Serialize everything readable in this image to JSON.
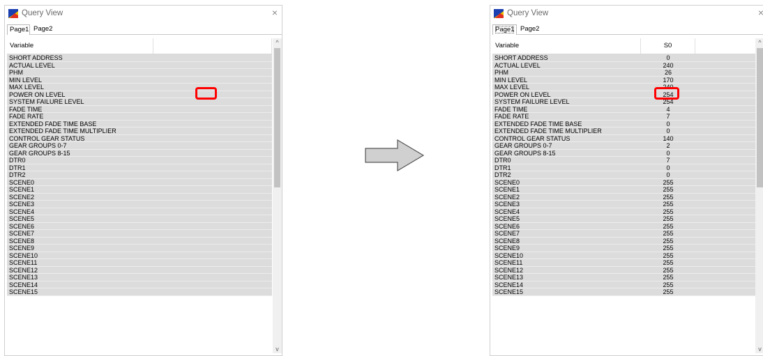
{
  "left_window": {
    "title": "Query View",
    "close_glyph": "×",
    "tabs": [
      "Page1",
      "Page2"
    ],
    "header": {
      "variable": "Variable",
      "value": ""
    },
    "rows": [
      {
        "name": "SHORT ADDRESS"
      },
      {
        "name": "ACTUAL LEVEL"
      },
      {
        "name": "PHM"
      },
      {
        "name": "MIN LEVEL"
      },
      {
        "name": "MAX LEVEL"
      },
      {
        "name": "POWER ON LEVEL"
      },
      {
        "name": "SYSTEM FAILURE LEVEL"
      },
      {
        "name": "FADE TIME"
      },
      {
        "name": "FADE RATE"
      },
      {
        "name": "EXTENDED FADE TIME BASE"
      },
      {
        "name": "EXTENDED FADE TIME MULTIPLIER"
      },
      {
        "name": "CONTROL GEAR STATUS"
      },
      {
        "name": "GEAR GROUPS 0-7"
      },
      {
        "name": "GEAR GROUPS 8-15"
      },
      {
        "name": "DTR0"
      },
      {
        "name": "DTR1"
      },
      {
        "name": "DTR2"
      },
      {
        "name": "SCENE0"
      },
      {
        "name": "SCENE1"
      },
      {
        "name": "SCENE2"
      },
      {
        "name": "SCENE3"
      },
      {
        "name": "SCENE4"
      },
      {
        "name": "SCENE5"
      },
      {
        "name": "SCENE6"
      },
      {
        "name": "SCENE7"
      },
      {
        "name": "SCENE8"
      },
      {
        "name": "SCENE9"
      },
      {
        "name": "SCENE10"
      },
      {
        "name": "SCENE11"
      },
      {
        "name": "SCENE12"
      },
      {
        "name": "SCENE13"
      },
      {
        "name": "SCENE14"
      },
      {
        "name": "SCENE15"
      }
    ],
    "scroll_up": "^",
    "scroll_down": "v"
  },
  "right_window": {
    "title": "Query View",
    "close_glyph": "×",
    "tabs": [
      "Page1",
      "Page2"
    ],
    "header": {
      "variable": "Variable",
      "value": "S0"
    },
    "rows": [
      {
        "name": "SHORT ADDRESS",
        "value": "0"
      },
      {
        "name": "ACTUAL LEVEL",
        "value": "240"
      },
      {
        "name": "PHM",
        "value": "26"
      },
      {
        "name": "MIN LEVEL",
        "value": "170"
      },
      {
        "name": "MAX LEVEL",
        "value": "240"
      },
      {
        "name": "POWER ON LEVEL",
        "value": "254"
      },
      {
        "name": "SYSTEM FAILURE LEVEL",
        "value": "254"
      },
      {
        "name": "FADE TIME",
        "value": "4"
      },
      {
        "name": "FADE RATE",
        "value": "7"
      },
      {
        "name": "EXTENDED FADE TIME BASE",
        "value": "0"
      },
      {
        "name": "EXTENDED FADE TIME MULTIPLIER",
        "value": "0"
      },
      {
        "name": "CONTROL GEAR STATUS",
        "value": "140"
      },
      {
        "name": "GEAR GROUPS 0-7",
        "value": "2"
      },
      {
        "name": "GEAR GROUPS 8-15",
        "value": "0"
      },
      {
        "name": "DTR0",
        "value": "7"
      },
      {
        "name": "DTR1",
        "value": "0"
      },
      {
        "name": "DTR2",
        "value": "0"
      },
      {
        "name": "SCENE0",
        "value": "255"
      },
      {
        "name": "SCENE1",
        "value": "255"
      },
      {
        "name": "SCENE2",
        "value": "255"
      },
      {
        "name": "SCENE3",
        "value": "255"
      },
      {
        "name": "SCENE4",
        "value": "255"
      },
      {
        "name": "SCENE5",
        "value": "255"
      },
      {
        "name": "SCENE6",
        "value": "255"
      },
      {
        "name": "SCENE7",
        "value": "255"
      },
      {
        "name": "SCENE8",
        "value": "255"
      },
      {
        "name": "SCENE9",
        "value": "255"
      },
      {
        "name": "SCENE10",
        "value": "255"
      },
      {
        "name": "SCENE11",
        "value": "255"
      },
      {
        "name": "SCENE12",
        "value": "255"
      },
      {
        "name": "SCENE13",
        "value": "255"
      },
      {
        "name": "SCENE14",
        "value": "255"
      },
      {
        "name": "SCENE15",
        "value": "255"
      }
    ],
    "scroll_up": "^",
    "scroll_down": "v"
  },
  "highlight_color": "#ff0000",
  "row_color": "#dcdcdc",
  "arrow_fill": "#d0d0d0",
  "icons": [
    "app-icon",
    "close-icon",
    "scroll-up-icon",
    "scroll-down-icon",
    "right-arrow-icon"
  ]
}
